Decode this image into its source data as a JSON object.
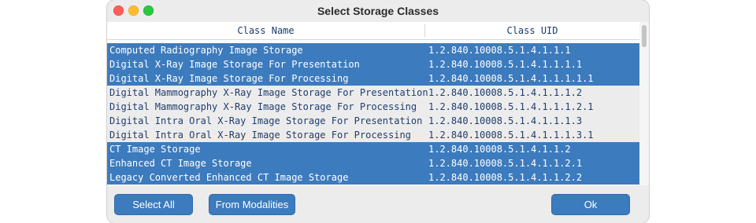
{
  "window": {
    "title": "Select Storage Classes"
  },
  "table": {
    "columns": [
      "Class Name",
      "Class UID"
    ],
    "rows": [
      {
        "name": "Computed Radiography Image Storage",
        "uid": "1.2.840.10008.5.1.4.1.1.1",
        "selected": true
      },
      {
        "name": "Digital X-Ray Image Storage For Presentation",
        "uid": "1.2.840.10008.5.1.4.1.1.1.1",
        "selected": true
      },
      {
        "name": "Digital X-Ray Image Storage For Processing",
        "uid": "1.2.840.10008.5.1.4.1.1.1.1.1",
        "selected": true
      },
      {
        "name": "Digital Mammography X-Ray Image Storage For Presentation",
        "uid": "1.2.840.10008.5.1.4.1.1.1.2",
        "selected": false
      },
      {
        "name": "Digital Mammography X-Ray Image Storage For Processing",
        "uid": "1.2.840.10008.5.1.4.1.1.1.2.1",
        "selected": false
      },
      {
        "name": "Digital Intra Oral X-Ray Image Storage For Presentation",
        "uid": "1.2.840.10008.5.1.4.1.1.1.3",
        "selected": false
      },
      {
        "name": "Digital Intra Oral X-Ray Image Storage For Processing",
        "uid": "1.2.840.10008.5.1.4.1.1.1.3.1",
        "selected": false
      },
      {
        "name": "CT Image Storage",
        "uid": "1.2.840.10008.5.1.4.1.1.2",
        "selected": true
      },
      {
        "name": "Enhanced CT Image Storage",
        "uid": "1.2.840.10008.5.1.4.1.1.2.1",
        "selected": true
      },
      {
        "name": "Legacy Converted Enhanced CT Image Storage",
        "uid": "1.2.840.10008.5.1.4.1.1.2.2",
        "selected": true
      }
    ]
  },
  "buttons": {
    "select_all": "Select All",
    "from_modalities": "From Modalities",
    "ok": "Ok"
  },
  "colors": {
    "selection": "#3c7bbd",
    "close": "#fe5f57",
    "minimize": "#febc2e",
    "maximize": "#28c840"
  }
}
